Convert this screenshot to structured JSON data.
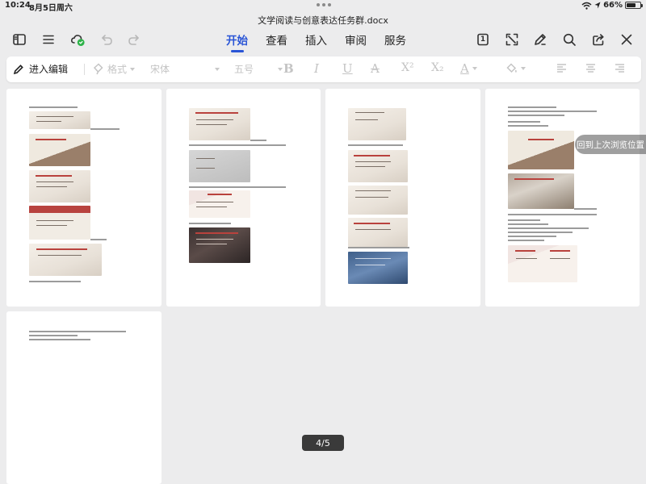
{
  "status_bar": {
    "time": "10:24",
    "date": "8月5日周六",
    "battery": "66%",
    "battery_level": 0.66
  },
  "document": {
    "title": "文学阅读与创意表达任务群.docx"
  },
  "main_toolbar": {
    "tabs": [
      {
        "label": "开始",
        "active": true
      },
      {
        "label": "查看",
        "active": false
      },
      {
        "label": "插入",
        "active": false
      },
      {
        "label": "审阅",
        "active": false
      },
      {
        "label": "服务",
        "active": false
      }
    ],
    "icons": {
      "sidebar": "sidebar-icon",
      "menu": "menu-icon",
      "cloud": "cloud-sync-icon",
      "undo": "undo-icon",
      "redo": "redo-icon",
      "page_count": "page-count-icon",
      "page_count_value": "1",
      "fullscreen": "fullscreen-icon",
      "annotate": "pen-icon",
      "search": "search-icon",
      "share": "share-icon",
      "close": "close-icon"
    }
  },
  "format_toolbar": {
    "edit_label": "进入编辑",
    "style_label": "格式",
    "font_label": "宋体",
    "size_label": "五号",
    "bold": "B",
    "italic": "I",
    "underline": "U",
    "strike": "A",
    "superscript": "X²",
    "subscript": "X₂",
    "font_color": "A"
  },
  "overlay": {
    "back_to_last_position": "回到上次浏览位置",
    "page_counter": "4/5"
  },
  "colors": {
    "accent": "#2a55d6",
    "sync_badge": "#2fb34a",
    "background": "#ececed"
  }
}
